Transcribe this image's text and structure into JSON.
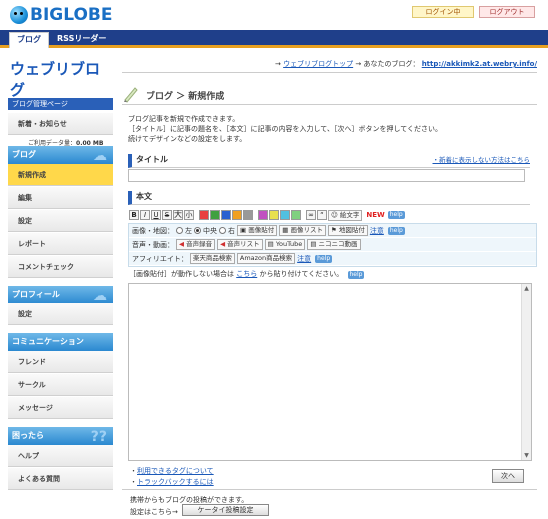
{
  "header": {
    "logo_text": "BIGLOBE",
    "login_label": "ログイン中",
    "logout_label": "ログアウト"
  },
  "tabs": [
    {
      "label": "ブログ"
    },
    {
      "label": "RSSリーダー"
    }
  ],
  "sidebar": {
    "title": "ウェブリブログ",
    "usage_label": "ご利用データ量：",
    "usage_value": "0.00 MB",
    "manage_bar": "ブログ管理ページ",
    "news": "新着・お知らせ",
    "sections": [
      {
        "title": "ブログ",
        "items": [
          "新規作成",
          "編集",
          "設定",
          "レポート",
          "コメントチェック"
        ]
      },
      {
        "title": "プロフィール",
        "items": [
          "設定"
        ]
      },
      {
        "title": "コミュニケーション",
        "items": [
          "フレンド",
          "サークル",
          "メッセージ"
        ]
      },
      {
        "title": "困ったら",
        "items": [
          "ヘルプ",
          "よくある質問"
        ]
      }
    ]
  },
  "topbar": {
    "arrow1": "→",
    "link_top": "ウェブリブログトップ",
    "arrow2": "→ あなたのブログ：",
    "blog_url": "http://akkimk2.at.webry.info/"
  },
  "page": {
    "breadcrumb": "ブログ ＞ 新規作成",
    "intro": [
      "ブログ記事を新規で作成できます。",
      "［タイトル］に記事の題名を、［本文］に記事の内容を入力して、［次へ］ボタンを押してください。",
      "続けてデザインなどの設定をします。"
    ],
    "title_section": "タイトル",
    "title_link": "・新着に表示しない方法はこちら",
    "body_section": "本文",
    "new_badge": "NEW",
    "help": "help",
    "row_image_label": "画像・地図：",
    "align_left": "左",
    "align_center": "中央",
    "align_right": "右",
    "btn_image_paste": "画像貼付",
    "btn_image_list": "画像リスト",
    "btn_map_paste": "地図貼付",
    "attention": "注意",
    "row_audio_label": "音声・動画：",
    "btn_audio_record": "音声録音",
    "btn_audio_list": "音声リスト",
    "btn_youtube": "YouTube",
    "btn_nico": "ニコニコ動画",
    "row_affiliate_label": "アフィリエイト：",
    "btn_rakuten": "楽天商品検索",
    "btn_amazon": "Amazon商品検索",
    "note_pre": "［画像貼付］が動作しない場合は",
    "note_link": "こちら",
    "note_post": "から貼り付けてください。",
    "link_tags": "利用できるタグについて",
    "link_trackback": "トラックバックするには",
    "next_button": "次へ",
    "mobile_text1": "携帯からもブログの投稿ができます。",
    "mobile_text2": "設定はこちら→",
    "mobile_button": "ケータイ投稿設定"
  }
}
